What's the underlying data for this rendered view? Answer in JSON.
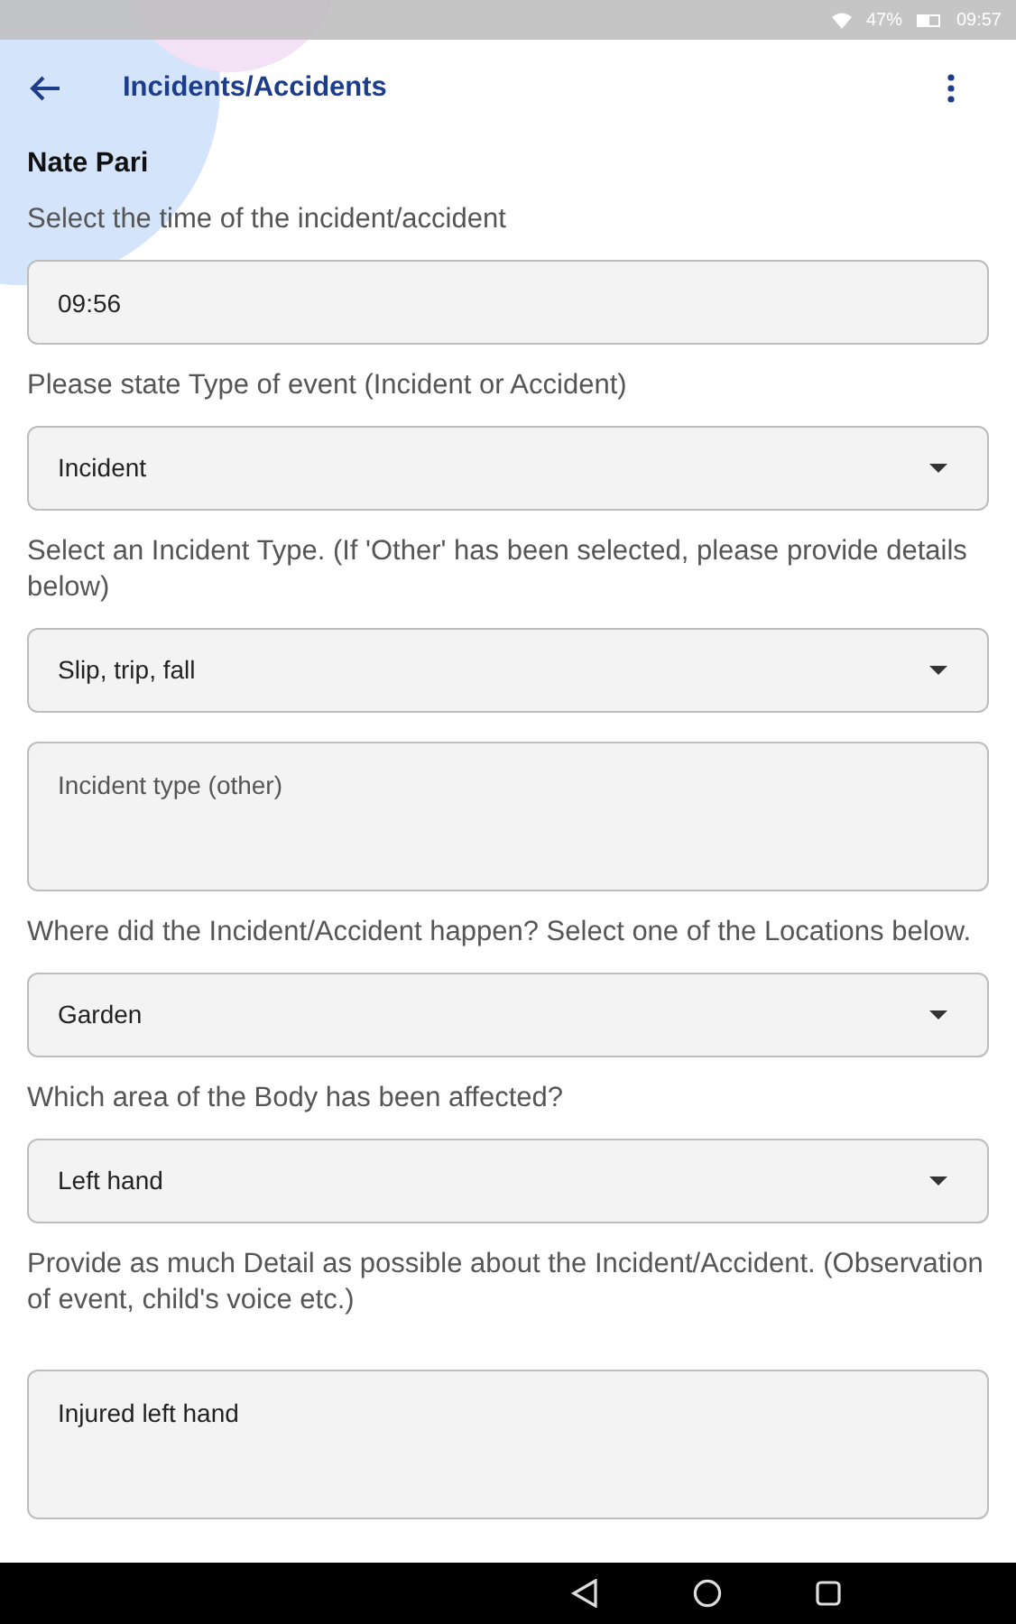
{
  "status_bar": {
    "battery": "47%",
    "time": "09:57"
  },
  "app_bar": {
    "title": "Incidents/Accidents"
  },
  "child_name": "Nate Pari",
  "form": [
    {
      "kind": "label",
      "text": "Select the time of the incident/accident"
    },
    {
      "kind": "input",
      "value": "09:56"
    },
    {
      "kind": "label",
      "text": "Please state Type of event (Incident or Accident)"
    },
    {
      "kind": "select",
      "value": "Incident"
    },
    {
      "kind": "label",
      "text": "Select an Incident Type. (If 'Other' has been selected, please provide details below)"
    },
    {
      "kind": "select",
      "value": "Slip, trip, fall"
    },
    {
      "kind": "textarea",
      "placeholder": "Incident type (other)"
    },
    {
      "kind": "label",
      "text": "Where did the Incident/Accident happen? Select one of the Locations below."
    },
    {
      "kind": "select",
      "value": "Garden"
    },
    {
      "kind": "label",
      "text": "Which area of the Body has been affected?"
    },
    {
      "kind": "select",
      "value": "Left hand"
    },
    {
      "kind": "label",
      "text": "Provide as much Detail as possible about the Incident/Accident. (Observation of event, child's voice etc.)"
    },
    {
      "kind": "textarea",
      "value": "Injured left hand"
    }
  ]
}
